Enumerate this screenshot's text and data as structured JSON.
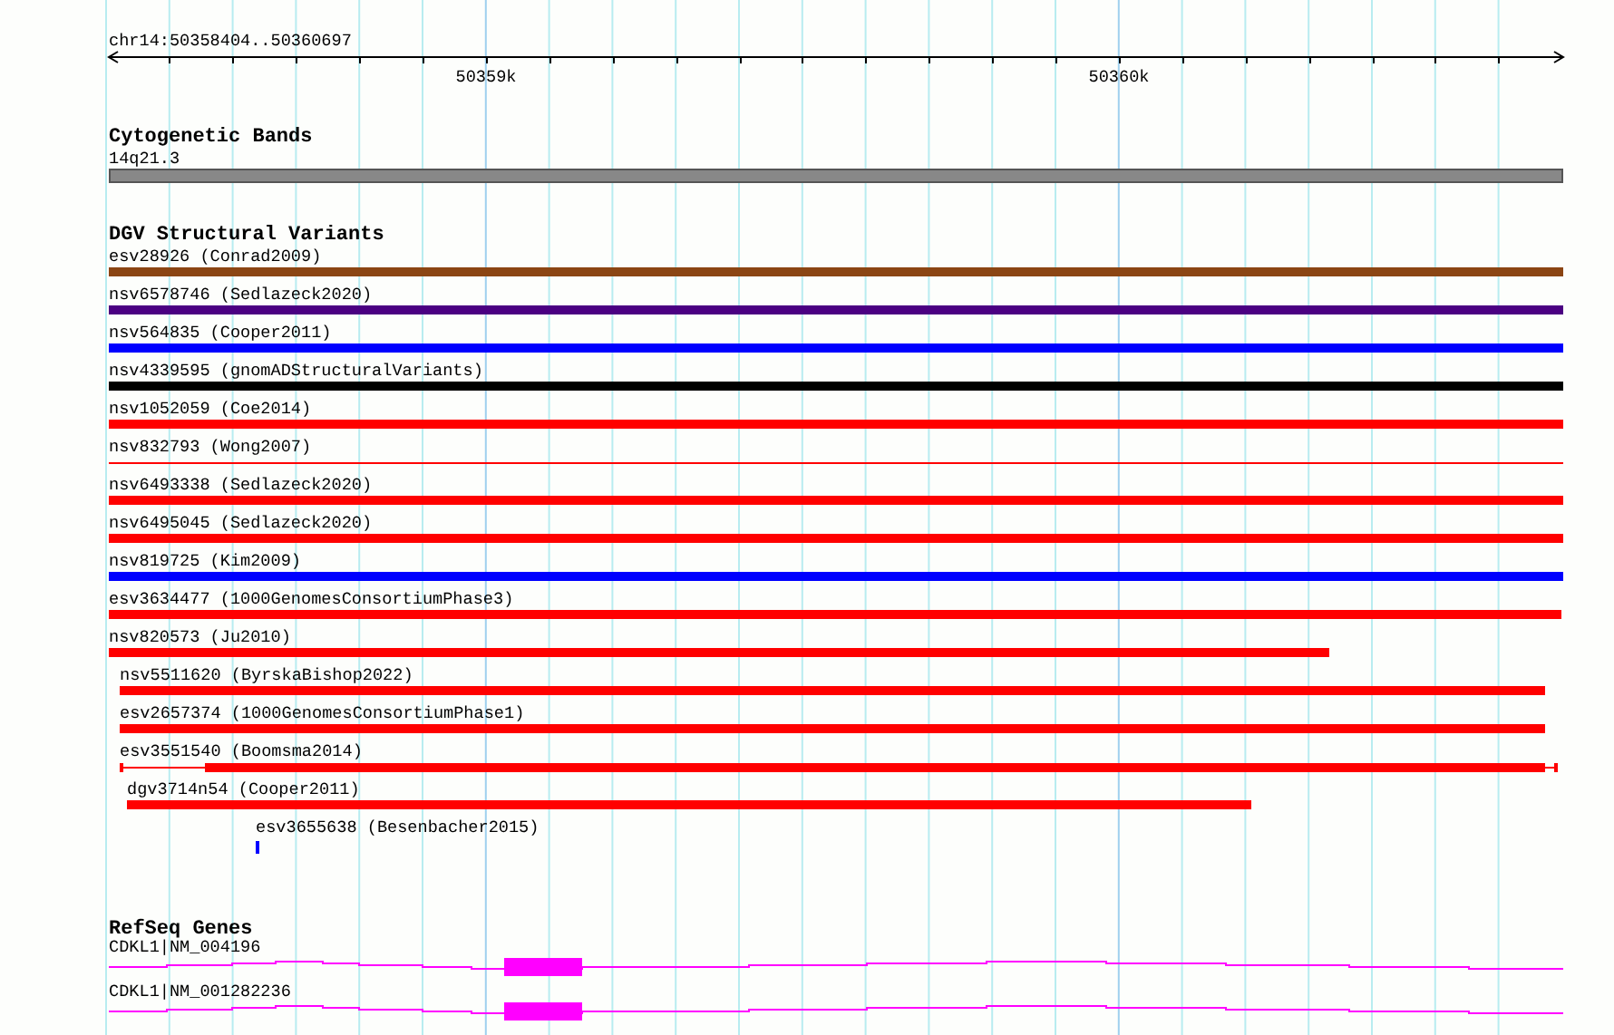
{
  "ruler": {
    "location": "chr14:50358404..50360697",
    "tick_labels": [
      "50359k",
      "50360k"
    ]
  },
  "tracks": [
    {
      "title": "Cytogenetic Bands",
      "kind": "cytoband",
      "features": [
        {
          "label": "14q21.3"
        }
      ]
    },
    {
      "title": "DGV Structural Variants",
      "kind": "variants",
      "features": [
        {
          "label": "esv28926 (Conrad2009)",
          "color": "#8b4513"
        },
        {
          "label": "nsv6578746 (Sedlazeck2020)",
          "color": "#4b0082"
        },
        {
          "label": "nsv564835 (Cooper2011)",
          "color": "#0000ff"
        },
        {
          "label": "nsv4339595 (gnomADStructuralVariants)",
          "color": "#000000"
        },
        {
          "label": "nsv1052059 (Coe2014)",
          "color": "#ff0000"
        },
        {
          "label": "nsv832793 (Wong2007)",
          "color": "#ff0000"
        },
        {
          "label": "nsv6493338 (Sedlazeck2020)",
          "color": "#ff0000"
        },
        {
          "label": "nsv6495045 (Sedlazeck2020)",
          "color": "#ff0000"
        },
        {
          "label": "nsv819725 (Kim2009)",
          "color": "#0000ff"
        },
        {
          "label": "esv3634477 (1000GenomesConsortiumPhase3)",
          "color": "#ff0000"
        },
        {
          "label": "nsv820573 (Ju2010)",
          "color": "#ff0000"
        },
        {
          "label": "nsv5511620 (ByrskaBishop2022)",
          "color": "#ff0000"
        },
        {
          "label": "esv2657374 (1000GenomesConsortiumPhase1)",
          "color": "#ff0000"
        },
        {
          "label": "esv3551540 (Boomsma2014)",
          "color": "#ff0000"
        },
        {
          "label": "dgv3714n54 (Cooper2011)",
          "color": "#ff0000"
        },
        {
          "label": "esv3655638 (Besenbacher2015)",
          "color": "#0000ff"
        }
      ]
    },
    {
      "title": "RefSeq Genes",
      "kind": "genes",
      "features": [
        {
          "label": "CDKL1|NM_004196"
        },
        {
          "label": "CDKL1|NM_001282236"
        }
      ]
    }
  ]
}
